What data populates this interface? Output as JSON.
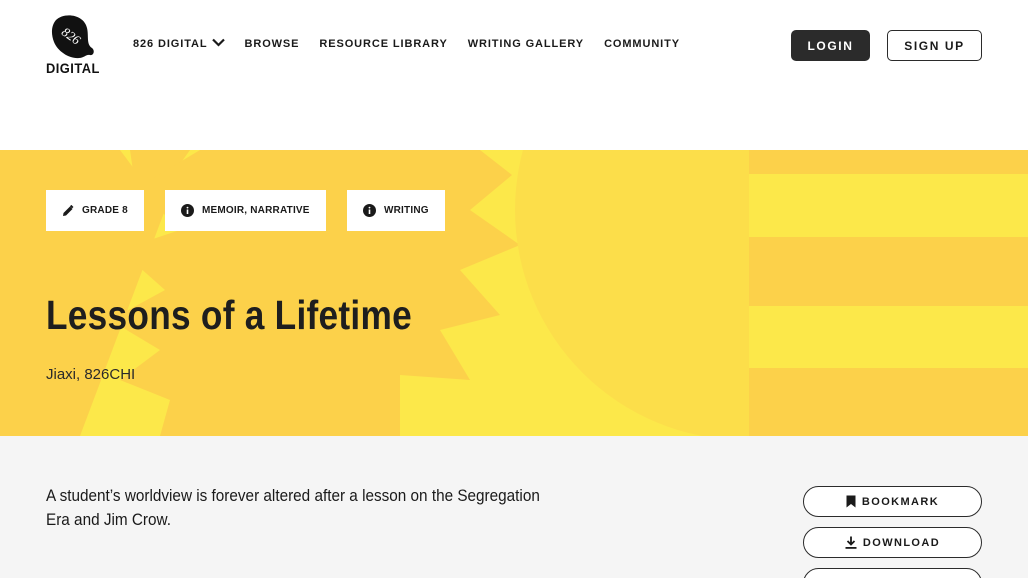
{
  "brand": {
    "logo_number": "826",
    "logo_word": "DIGITAL"
  },
  "nav": {
    "items": [
      {
        "label": "826 DIGITAL",
        "has_dropdown": true
      },
      {
        "label": "BROWSE"
      },
      {
        "label": "RESOURCE LIBRARY"
      },
      {
        "label": "WRITING GALLERY"
      },
      {
        "label": "COMMUNITY"
      }
    ],
    "login_label": "LOGIN",
    "signup_label": "SIGN UP"
  },
  "hero": {
    "tags": [
      {
        "label": "GRADE 8",
        "icon": "pencil-icon"
      },
      {
        "label": "MEMOIR, NARRATIVE",
        "icon": "info-icon"
      },
      {
        "label": "WRITING",
        "icon": "info-icon"
      }
    ],
    "title": "Lessons of a Lifetime",
    "author": "Jiaxi, 826CHI",
    "colors": {
      "background": "#fce84a",
      "shape": "#fcd14a"
    }
  },
  "content": {
    "summary": "A student’s worldview is forever altered after a lesson on the Segregation Era and Jim Crow.",
    "actions": [
      {
        "label": "BOOKMARK",
        "icon": "bookmark-icon"
      },
      {
        "label": "DOWNLOAD",
        "icon": "download-icon"
      },
      {
        "label": "",
        "icon": ""
      }
    ]
  }
}
